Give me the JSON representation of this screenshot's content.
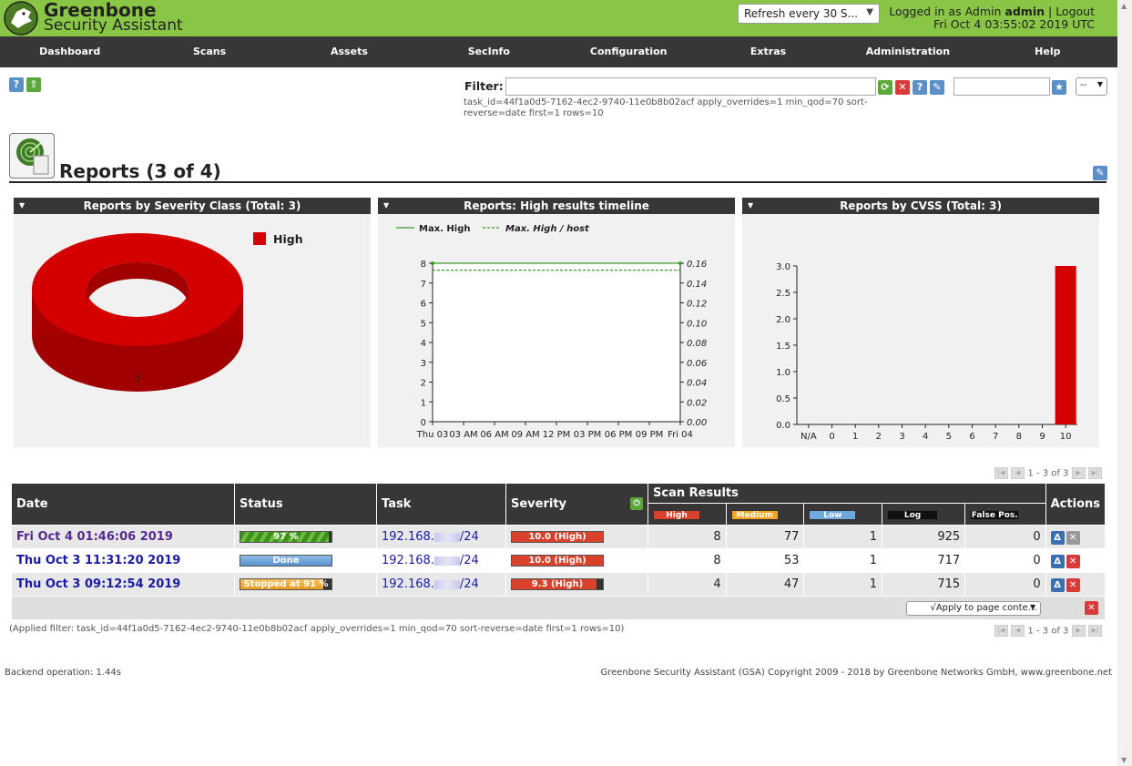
{
  "header": {
    "logo_line1": "Greenbone",
    "logo_line2": "Security Assistant",
    "refresh": "Refresh every 30 S...",
    "logged_in_prefix": "Logged in as  Admin",
    "user": "admin",
    "logout": "Logout",
    "datetime": "Fri Oct 4 03:55:02 2019 UTC"
  },
  "nav": [
    "Dashboard",
    "Scans",
    "Assets",
    "SecInfo",
    "Configuration",
    "Extras",
    "Administration",
    "Help"
  ],
  "filter": {
    "label": "Filter:",
    "value": "",
    "applied_text": "task_id=44f1a0d5-7162-4ec2-9740-11e0b8b02acf apply_overrides=1 min_qod=70 sort-reverse=date first=1 rows=10",
    "select": "--"
  },
  "page": {
    "title": "Reports (3 of 4)"
  },
  "charts": {
    "severity_title": "Reports by Severity Class (Total: 3)",
    "timeline_title": "Reports: High results timeline",
    "cvss_title": "Reports by CVSS (Total: 3)"
  },
  "chart_data": [
    {
      "type": "pie",
      "title": "Reports by Severity Class (Total: 3)",
      "categories": [
        "High"
      ],
      "values": [
        3
      ],
      "colors": [
        "#d40000"
      ],
      "legend": "top-right"
    },
    {
      "type": "line",
      "title": "Reports: High results timeline",
      "x": [
        "Thu 03",
        "03 AM",
        "06 AM",
        "09 AM",
        "12 PM",
        "03 PM",
        "06 PM",
        "09 PM",
        "Fri 04"
      ],
      "series": [
        {
          "name": "Max. High",
          "values": [
            8,
            8
          ],
          "axis": "left",
          "style": "solid"
        },
        {
          "name": "Max. High / host",
          "values": [
            0.153,
            0.153
          ],
          "axis": "right",
          "style": "dashed"
        }
      ],
      "ylim": [
        0,
        8
      ],
      "y2lim": [
        0,
        0.16
      ],
      "yticks": [
        "0",
        "1",
        "2",
        "3",
        "4",
        "5",
        "6",
        "7",
        "8"
      ],
      "y2ticks": [
        "0.00",
        "0.02",
        "0.04",
        "0.06",
        "0.08",
        "0.10",
        "0.12",
        "0.14",
        "0.16"
      ],
      "legend": "top"
    },
    {
      "type": "bar",
      "title": "Reports by CVSS (Total: 3)",
      "categories": [
        "N/A",
        "0",
        "1",
        "2",
        "3",
        "4",
        "5",
        "6",
        "7",
        "8",
        "9",
        "10"
      ],
      "values": [
        0,
        0,
        0,
        0,
        0,
        0,
        0,
        0,
        0,
        0,
        0,
        3
      ],
      "ylim": [
        0,
        3
      ],
      "yticks": [
        "0.0",
        "0.5",
        "1.0",
        "1.5",
        "2.0",
        "2.5",
        "3.0"
      ],
      "color": "#d40000"
    }
  ],
  "pager": {
    "text": "1 - 3 of 3"
  },
  "table": {
    "headers": {
      "date": "Date",
      "status": "Status",
      "task": "Task",
      "severity": "Severity",
      "scan_results": "Scan Results",
      "actions": "Actions",
      "high": "High",
      "medium": "Medium",
      "low": "Low",
      "log": "Log",
      "false_pos": "False Pos."
    },
    "rows": [
      {
        "date": "Fri Oct 4 01:46:06 2019",
        "status": "97 %",
        "status_progress": 97,
        "task_prefix": "192.168.",
        "task_suffix": "/24",
        "severity": "10.0 (High)",
        "severity_fraction": 1.0,
        "high": "8",
        "medium": "77",
        "low": "1",
        "log": "925",
        "false_pos": "0"
      },
      {
        "date": "Thu Oct 3 11:31:20 2019",
        "status": "Done",
        "status_progress": 100,
        "task_prefix": "192.168.",
        "task_suffix": "/24",
        "severity": "10.0 (High)",
        "severity_fraction": 1.0,
        "high": "8",
        "medium": "53",
        "low": "1",
        "log": "717",
        "false_pos": "0"
      },
      {
        "date": "Thu Oct 3 09:12:54 2019",
        "status": "Stopped at 91 %",
        "status_progress": 91,
        "task_prefix": "192.168.",
        "task_suffix": "/24",
        "severity": "9.3 (High)",
        "severity_fraction": 0.93,
        "high": "4",
        "medium": "47",
        "low": "1",
        "log": "715",
        "false_pos": "0"
      }
    ],
    "apply_select": "√Apply to page conte..."
  },
  "footer": {
    "applied_filter": "(Applied filter: task_id=44f1a0d5-7162-4ec2-9740-11e0b8b02acf apply_overrides=1 min_qod=70 sort-reverse=date first=1 rows=10)",
    "backend": "Backend operation: 1.44s",
    "copyright": "Greenbone Security Assistant (GSA) Copyright 2009 - 2018 by Greenbone Networks GmbH, www.greenbone.net"
  },
  "colors": {
    "header_green": "#8ac646",
    "nav_dark": "#393637",
    "high_red": "#d40000",
    "medium_orange": "#f5a623",
    "low_blue": "#6fa8dc",
    "done_blue": "#6fa1d6"
  }
}
